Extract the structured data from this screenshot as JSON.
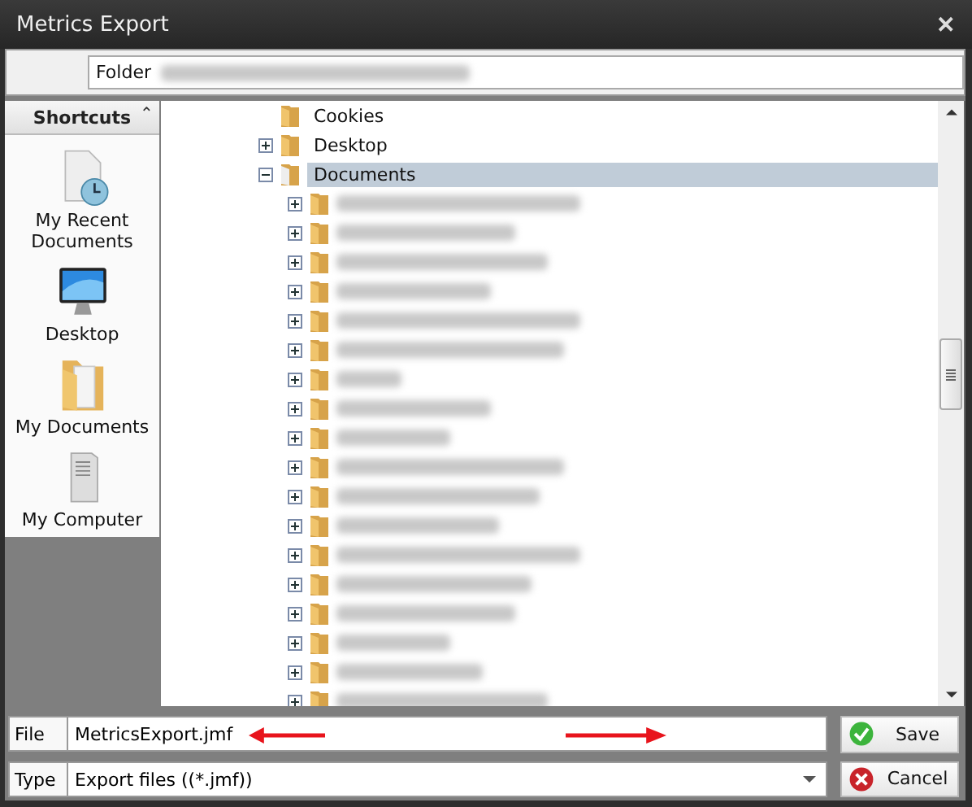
{
  "window": {
    "title": "Metrics Export",
    "close": "✕"
  },
  "folder_bar": {
    "label": "Folder"
  },
  "shortcuts": {
    "title": "Shortcuts",
    "collapse": "⌃",
    "items": [
      {
        "label": "My Recent Documents",
        "kind": "recent"
      },
      {
        "label": "Desktop",
        "kind": "desktop"
      },
      {
        "label": "My Documents",
        "kind": "documents"
      },
      {
        "label": "My Computer",
        "kind": "computer"
      }
    ]
  },
  "tree": [
    {
      "label": "Cookies",
      "expandable": false,
      "expanded": false,
      "selected": false
    },
    {
      "label": "Desktop",
      "expandable": true,
      "expanded": false,
      "selected": false
    },
    {
      "label": "Documents",
      "expandable": true,
      "expanded": true,
      "selected": true,
      "children": [
        {
          "kind": "redacted"
        },
        {
          "kind": "redacted"
        },
        {
          "kind": "redacted"
        },
        {
          "kind": "redacted"
        },
        {
          "kind": "redacted"
        },
        {
          "kind": "redacted"
        },
        {
          "kind": "redacted"
        },
        {
          "kind": "redacted"
        },
        {
          "kind": "redacted"
        },
        {
          "kind": "redacted"
        },
        {
          "kind": "redacted"
        },
        {
          "kind": "redacted"
        },
        {
          "kind": "redacted"
        },
        {
          "kind": "redacted"
        },
        {
          "kind": "redacted"
        },
        {
          "kind": "redacted"
        },
        {
          "kind": "redacted"
        },
        {
          "kind": "redacted"
        }
      ]
    }
  ],
  "file": {
    "label": "File",
    "value": "MetricsExport.jmf"
  },
  "type": {
    "label": "Type",
    "value": "Export files ((*.jmf))"
  },
  "buttons": [
    {
      "label": "Save",
      "kind": "save"
    },
    {
      "label": "Cancel",
      "kind": "cancel"
    }
  ],
  "annotations": [
    {
      "kind": "arrow-left"
    },
    {
      "kind": "arrow-right"
    }
  ]
}
